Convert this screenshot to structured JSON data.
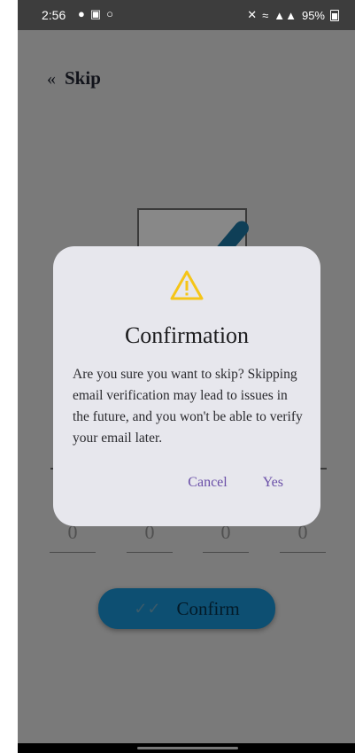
{
  "status_bar": {
    "time": "2:56",
    "battery": "95%",
    "notification_icons": [
      "snapchat-icon",
      "gallery-icon",
      "whatsapp-icon"
    ],
    "system_icons": [
      "mute-icon",
      "wifi-icon",
      "signal-icon",
      "signal-icon"
    ]
  },
  "header": {
    "skip_icon": "«",
    "skip_label": "Skip"
  },
  "otp": {
    "digits": [
      "0",
      "0",
      "0",
      "0"
    ]
  },
  "confirm_button": {
    "icon": "✓✓",
    "label": "Confirm"
  },
  "dialog": {
    "icon": "warning-icon",
    "icon_color": "#f5c518",
    "title": "Confirmation",
    "message": "Are you sure you want to skip? Skipping email verification may lead to issues in the future, and you won't be able to verify your email later.",
    "cancel_label": "Cancel",
    "yes_label": "Yes",
    "button_color": "#6a4fa8"
  },
  "colors": {
    "scrim": "#7a7a7a",
    "dialog_bg": "#e7e7ed",
    "confirm_button_bg": "#0d4f72"
  }
}
